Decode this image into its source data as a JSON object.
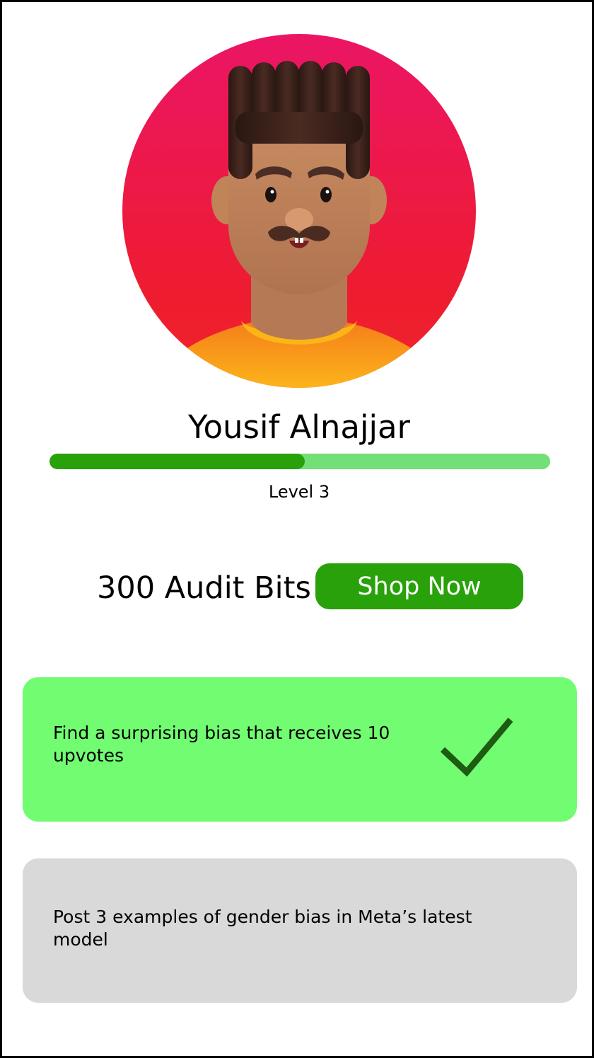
{
  "profile": {
    "name": "Yousif Alnajjar",
    "level_label": "Level 3",
    "level_progress": 0.51
  },
  "wallet": {
    "balance_label": "300 Audit Bits",
    "shop_button_label": "Shop Now"
  },
  "tasks": [
    {
      "text": "Find a surprising bias that receives 10 upvotes",
      "completed": true
    },
    {
      "text": "Post 3 examples of gender bias in Meta’s latest model",
      "completed": false
    }
  ],
  "colors": {
    "primary_green": "#29a10a",
    "progress_track": "#72e076",
    "completed_card": "#72fc72",
    "pending_card": "#d9d9d9",
    "check_mark": "#1e5c12"
  },
  "icons": {
    "avatar": "user-avatar-image",
    "completed": "checkmark-icon"
  }
}
